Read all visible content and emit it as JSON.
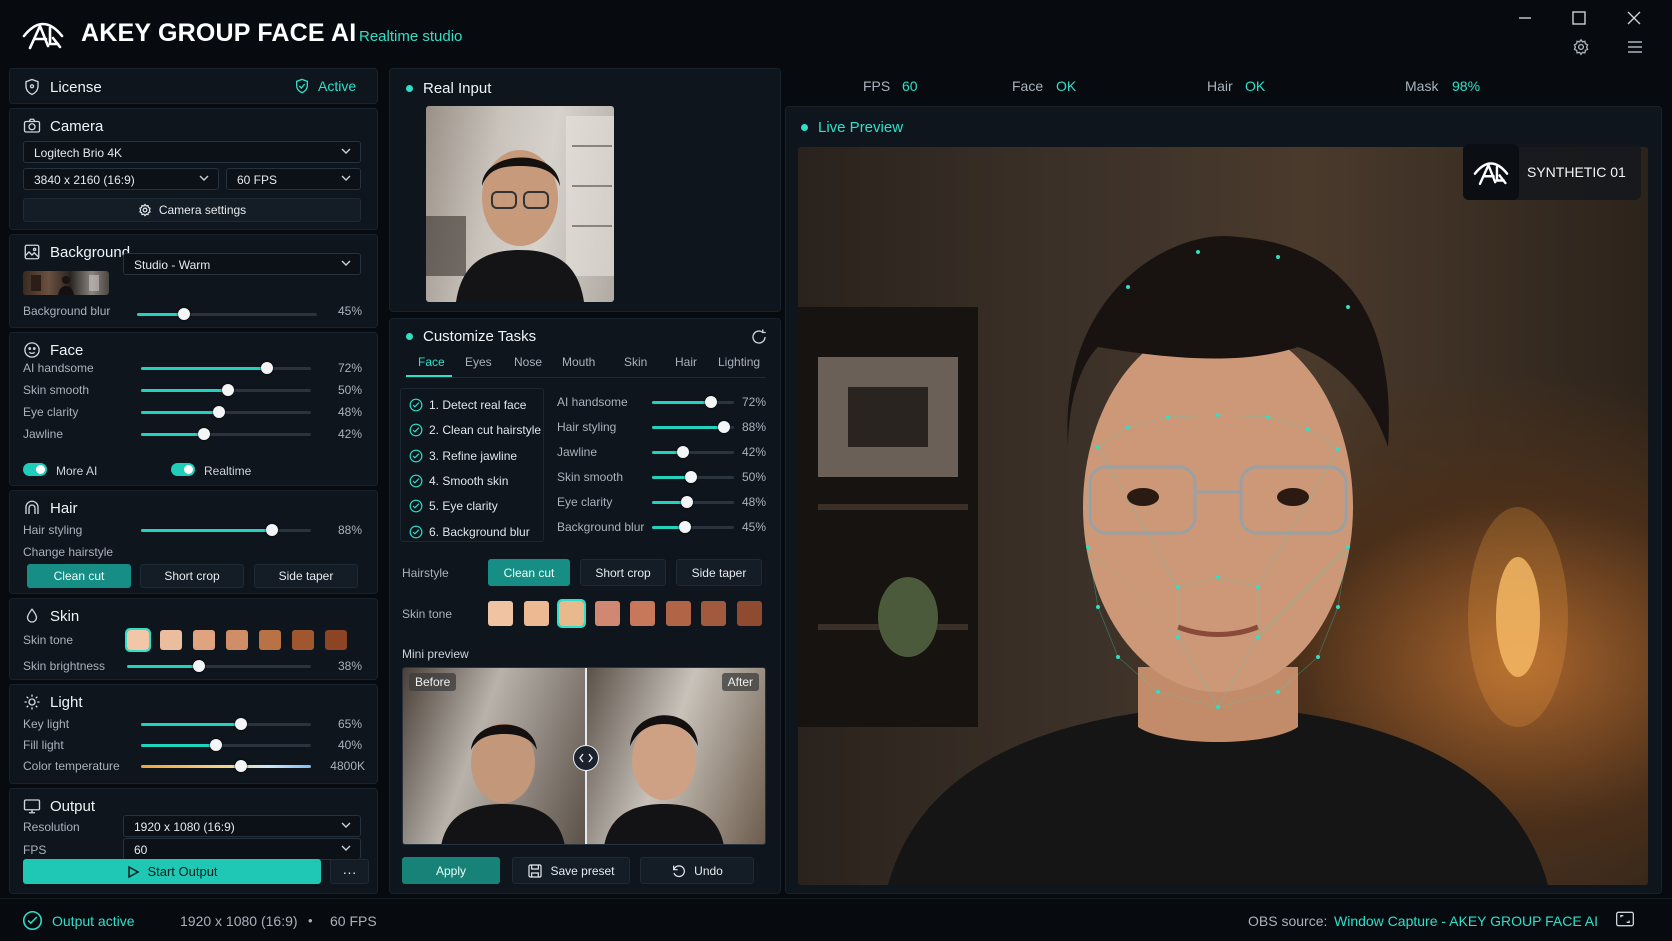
{
  "app": {
    "title": "AKEY GROUP FACE AI",
    "subtitle": "Realtime studio"
  },
  "colors": {
    "accent": "#2ee0c8",
    "panel": "#0e151d",
    "background": "#070b10"
  },
  "license": {
    "label": "License",
    "status": "Active"
  },
  "camera": {
    "label": "Camera",
    "device": "Logitech Brio 4K",
    "resolution": "3840 x 2160 (16:9)",
    "fps": "60 FPS",
    "settings_label": "Camera settings"
  },
  "background": {
    "label": "Background",
    "preset": "Studio - Warm",
    "blur_label": "Background blur",
    "blur_value": "45%",
    "blur": 0.26
  },
  "face": {
    "label": "Face",
    "sliders": [
      {
        "label": "AI handsome",
        "value": "72%",
        "level": 0.74
      },
      {
        "label": "Skin smooth",
        "value": "50%",
        "level": 0.51
      },
      {
        "label": "Eye clarity",
        "value": "48%",
        "level": 0.46
      },
      {
        "label": "Jawline",
        "value": "42%",
        "level": 0.37
      }
    ],
    "toggle1": "More AI",
    "toggle2": "Realtime"
  },
  "hair": {
    "label": "Hair",
    "styling_label": "Hair styling",
    "styling_value": "88%",
    "styling": 0.77,
    "change_label": "Change hairstyle",
    "options": [
      "Clean cut",
      "Short crop",
      "Side taper"
    ]
  },
  "skin": {
    "label": "Skin",
    "tone_label": "Skin tone",
    "tones": [
      "#f2c7a8",
      "#ebbc9d",
      "#dfa47f",
      "#cf8e67",
      "#b87245",
      "#a0572f",
      "#8c4424"
    ],
    "brightness_label": "Skin brightness",
    "brightness_value": "38%",
    "brightness": 0.39
  },
  "light": {
    "label": "Light",
    "key_label": "Key light",
    "key_value": "65%",
    "key": 0.59,
    "fill_label": "Fill light",
    "fill_value": "40%",
    "fill": 0.44,
    "temp_label": "Color temperature",
    "temp_value": "4800K",
    "temp": 0.59
  },
  "output": {
    "label": "Output",
    "resolution_label": "Resolution",
    "resolution": "1920 x 1080 (16:9)",
    "fps_label": "FPS",
    "fps": "60",
    "start_label": "Start Output",
    "more": "···"
  },
  "stats": {
    "fps_label": "FPS",
    "fps": "60",
    "face_label": "Face",
    "face": "OK",
    "hair_label": "Hair",
    "hair": "OK",
    "mask_label": "Mask",
    "mask": "98%"
  },
  "real_input": {
    "label": "Real Input"
  },
  "tasks": {
    "label": "Customize Tasks",
    "tabs": [
      "Face",
      "Eyes",
      "Nose",
      "Mouth",
      "Skin",
      "Hair",
      "Lighting"
    ],
    "list": [
      "1. Detect real face",
      "2. Clean cut hairstyle",
      "3. Refine jawline",
      "4. Smooth skin",
      "5. Eye clarity",
      "6. Background blur"
    ],
    "sliders": [
      {
        "label": "AI handsome",
        "value": "72%",
        "level": 0.72
      },
      {
        "label": "Hair styling",
        "value": "88%",
        "level": 0.88
      },
      {
        "label": "Jawline",
        "value": "42%",
        "level": 0.38
      },
      {
        "label": "Skin smooth",
        "value": "50%",
        "level": 0.47
      },
      {
        "label": "Eye clarity",
        "value": "48%",
        "level": 0.43
      },
      {
        "label": "Background blur",
        "value": "45%",
        "level": 0.4
      }
    ],
    "hairstyle_label": "Hairstyle",
    "hairstyles": [
      "Clean cut",
      "Short crop",
      "Side taper"
    ],
    "skintone_label": "Skin tone",
    "tones": [
      "#f0c4a3",
      "#ecb993",
      "#e8b98d",
      "#d08873",
      "#c7775a",
      "#b26447",
      "#a15a3d",
      "#8e4b2f"
    ],
    "mini_label": "Mini preview",
    "before": "Before",
    "after": "After",
    "apply": "Apply",
    "save": "Save preset",
    "undo": "Undo"
  },
  "preview": {
    "label": "Live Preview",
    "badge": "SYNTHETIC 01"
  },
  "status": {
    "output": "Output active",
    "resolution": "1920 x 1080 (16:9)",
    "sep": "•",
    "fps": "60 FPS",
    "obs_label": "OBS source:",
    "obs_value": "Window Capture - AKEY GROUP FACE AI"
  }
}
